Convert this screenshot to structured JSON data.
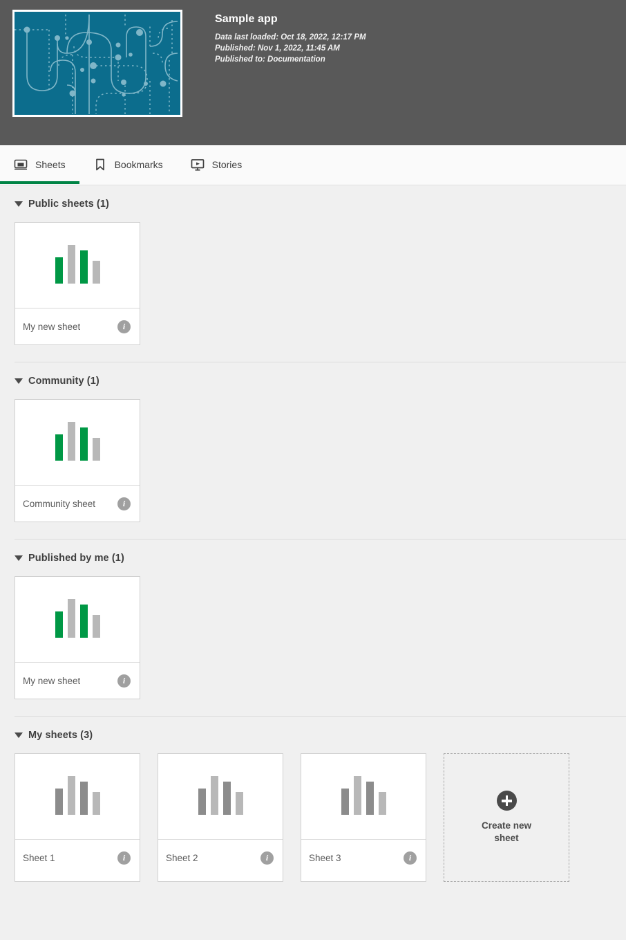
{
  "header": {
    "app_title": "Sample app",
    "thumbnail_bg": "#0c6d8d",
    "thumbnail_line_color": "#7fb6c8",
    "data_last_loaded": "Data last loaded: Oct 18, 2022, 12:17 PM",
    "published": "Published: Nov 1, 2022, 11:45 AM",
    "published_to": "Published to: Documentation",
    "background": "#595959"
  },
  "tabs": [
    {
      "label": "Sheets",
      "icon": "sheets-icon",
      "active": true
    },
    {
      "label": "Bookmarks",
      "icon": "bookmark-icon",
      "active": false
    },
    {
      "label": "Stories",
      "icon": "stories-icon",
      "active": false
    }
  ],
  "accent_color": "#008445",
  "colors": {
    "bar_green": "#009845",
    "bar_gray_light": "#b8b8b8",
    "bar_gray_dark": "#8c8c8c",
    "page_background": "#f0f0f0",
    "card_background": "#ffffff"
  },
  "sections": [
    {
      "title": "Public sheets (1)",
      "count": 1,
      "show_divider": false,
      "has_create_tile": false,
      "sheets": [
        {
          "name": "My new sheet",
          "info_icon": "info-icon",
          "chart": {
            "type": "bar",
            "values": [
              38,
              56,
              48,
              33
            ],
            "colors": [
              "#009845",
              "#b8b8b8",
              "#009845",
              "#b8b8b8"
            ]
          }
        }
      ]
    },
    {
      "title": "Community (1)",
      "count": 1,
      "show_divider": true,
      "has_create_tile": false,
      "sheets": [
        {
          "name": "Community sheet",
          "info_icon": "info-icon",
          "chart": {
            "type": "bar",
            "values": [
              38,
              56,
              48,
              33
            ],
            "colors": [
              "#009845",
              "#b8b8b8",
              "#009845",
              "#b8b8b8"
            ]
          }
        }
      ]
    },
    {
      "title": "Published by me (1)",
      "count": 1,
      "show_divider": true,
      "has_create_tile": false,
      "sheets": [
        {
          "name": "My new sheet",
          "info_icon": "info-icon",
          "chart": {
            "type": "bar",
            "values": [
              38,
              56,
              48,
              33
            ],
            "colors": [
              "#009845",
              "#b8b8b8",
              "#009845",
              "#b8b8b8"
            ]
          }
        }
      ]
    },
    {
      "title": "My sheets (3)",
      "count": 3,
      "show_divider": true,
      "has_create_tile": true,
      "create_label": "Create new sheet",
      "create_icon": "plus-icon",
      "sheets": [
        {
          "name": "Sheet 1",
          "info_icon": "info-icon",
          "chart": {
            "type": "bar",
            "values": [
              38,
              56,
              48,
              33
            ],
            "colors": [
              "#8c8c8c",
              "#b8b8b8",
              "#8c8c8c",
              "#b8b8b8"
            ]
          }
        },
        {
          "name": "Sheet 2",
          "info_icon": "info-icon",
          "chart": {
            "type": "bar",
            "values": [
              38,
              56,
              48,
              33
            ],
            "colors": [
              "#8c8c8c",
              "#b8b8b8",
              "#8c8c8c",
              "#b8b8b8"
            ]
          }
        },
        {
          "name": "Sheet 3",
          "info_icon": "info-icon",
          "chart": {
            "type": "bar",
            "values": [
              38,
              56,
              48,
              33
            ],
            "colors": [
              "#8c8c8c",
              "#b8b8b8",
              "#8c8c8c",
              "#b8b8b8"
            ]
          }
        }
      ]
    }
  ]
}
